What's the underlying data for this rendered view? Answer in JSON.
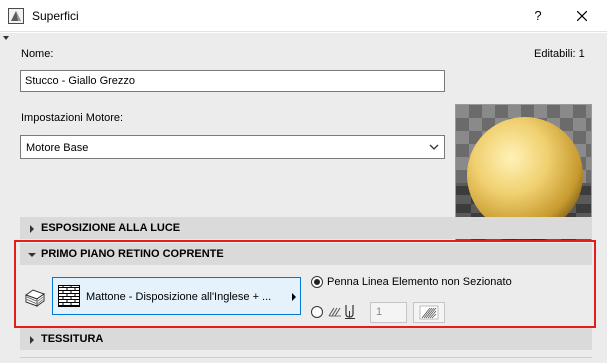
{
  "window": {
    "title": "Superfici",
    "help_label": "?"
  },
  "form": {
    "name_label": "Nome:",
    "editable_count": "Editabili: 1",
    "name_value": "Stucco - Giallo Grezzo",
    "engine_label": "Impostazioni Motore:",
    "engine_value": "Motore Base"
  },
  "sections": {
    "light": "ESPOSIZIONE ALLA LUCE",
    "cover_fill": "PRIMO PIANO RETINO COPRENTE",
    "texture": "TESSITURA"
  },
  "cover_fill": {
    "pattern_name": "Mattone - Disposizione all'Inglese + ...",
    "pen_option_label": "Penna Linea Elemento non Sezionato",
    "pen_option_selected": true,
    "pen_number": "1"
  },
  "icons": {
    "app": "window-app-icon",
    "close": "close-icon",
    "collapse": "chevron-down-icon",
    "preview": "material-preview-sphere",
    "fill_tool": "cover-fill-icon",
    "pattern": "brick-pattern-icon",
    "pen_override": "pen-override-icon",
    "pen_color": "pen-color-swatch"
  },
  "colors": {
    "highlight": "#e11e1e",
    "accent": "#0078d7",
    "material": "#f0d070"
  }
}
